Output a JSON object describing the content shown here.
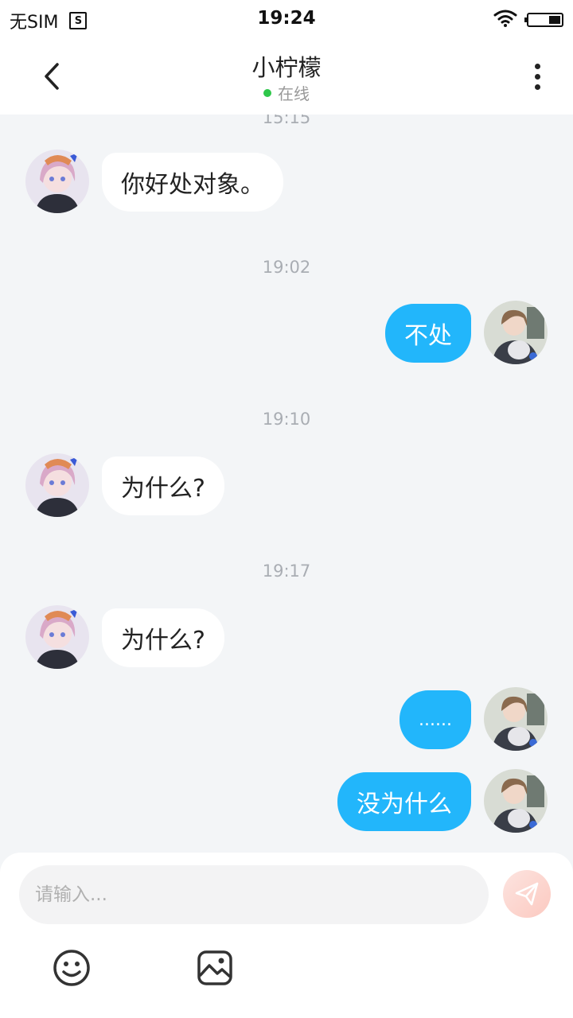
{
  "status_bar": {
    "carrier": "无SIM",
    "time": "19:24"
  },
  "header": {
    "title": "小柠檬",
    "status_text": "在线",
    "status_color": "#2ec74a"
  },
  "messages": [
    {
      "timestamp": "15:15",
      "from": "other",
      "text": "你好处对象。"
    },
    {
      "timestamp": "19:02",
      "from": "me",
      "text": "不处"
    },
    {
      "timestamp": "19:10",
      "from": "other",
      "text": "为什么?"
    },
    {
      "timestamp": "19:17",
      "from": "other",
      "text": "为什么?"
    },
    {
      "from": "me",
      "text": "......"
    },
    {
      "from": "me",
      "text": "没为什么"
    }
  ],
  "composer": {
    "placeholder": "请输入...",
    "send_icon": "paper-plane-icon",
    "tools": [
      "emoji-icon",
      "image-icon"
    ]
  },
  "colors": {
    "outgoing_bubble": "#22b6fb",
    "incoming_bubble": "#ffffff",
    "background": "#f3f5f7"
  }
}
